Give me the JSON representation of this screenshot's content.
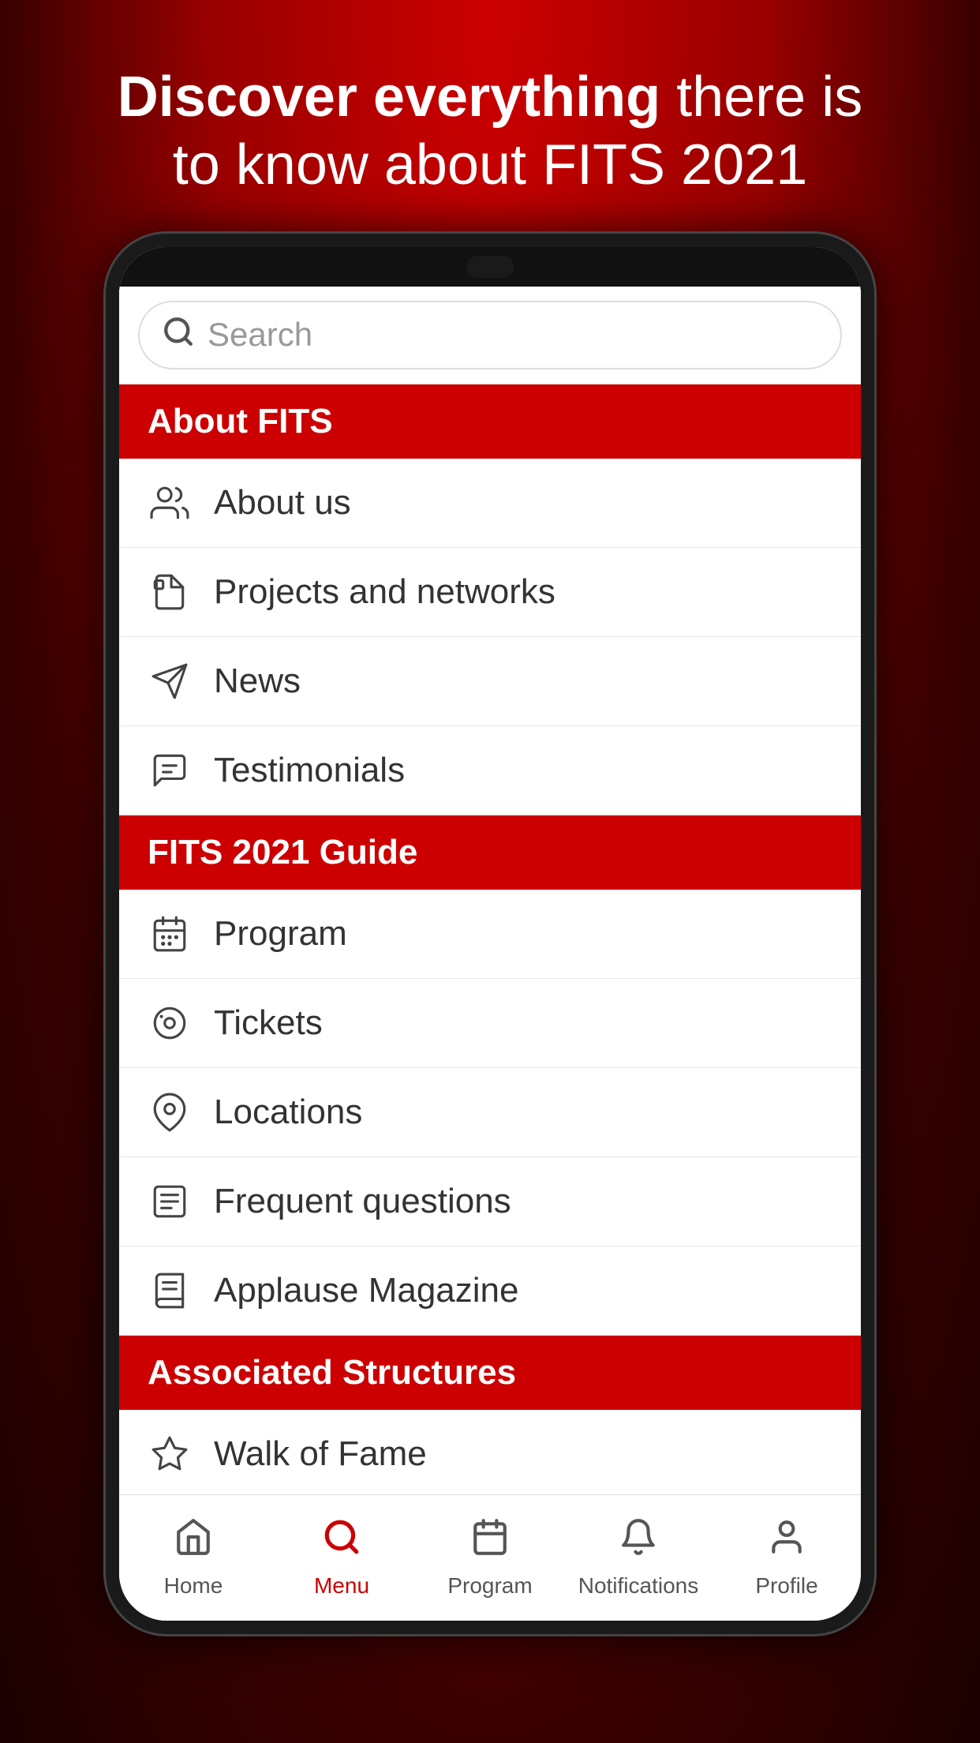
{
  "header": {
    "line1_bold": "Discover everything",
    "line1_rest": " there is",
    "line2": "to know about FITS 2021"
  },
  "search": {
    "placeholder": "Search"
  },
  "sections": [
    {
      "id": "about-fits",
      "label": "About FITS",
      "items": [
        {
          "id": "about-us",
          "label": "About us",
          "icon": "people"
        },
        {
          "id": "projects-networks",
          "label": "Projects and networks",
          "icon": "documents"
        },
        {
          "id": "news",
          "label": "News",
          "icon": "send"
        },
        {
          "id": "testimonials",
          "label": "Testimonials",
          "icon": "chat"
        }
      ]
    },
    {
      "id": "fits-guide",
      "label": "FITS 2021 Guide",
      "items": [
        {
          "id": "program",
          "label": "Program",
          "icon": "calendar"
        },
        {
          "id": "tickets",
          "label": "Tickets",
          "icon": "ticket"
        },
        {
          "id": "locations",
          "label": "Locations",
          "icon": "location"
        },
        {
          "id": "frequent-questions",
          "label": "Frequent questions",
          "icon": "faq"
        },
        {
          "id": "applause-magazine",
          "label": "Applause Magazine",
          "icon": "book"
        }
      ]
    },
    {
      "id": "associated-structures",
      "label": "Associated Structures",
      "items": [
        {
          "id": "walk-of-fame",
          "label": "Walk of Fame",
          "icon": "star"
        }
      ]
    }
  ],
  "bottom_nav": [
    {
      "id": "home",
      "label": "Home",
      "icon": "home",
      "active": false
    },
    {
      "id": "menu",
      "label": "Menu",
      "icon": "menu",
      "active": true
    },
    {
      "id": "program",
      "label": "Program",
      "icon": "calendar-nav",
      "active": false
    },
    {
      "id": "notifications",
      "label": "Notifications",
      "icon": "bell",
      "active": false
    },
    {
      "id": "profile",
      "label": "Profile",
      "icon": "person",
      "active": false
    }
  ]
}
